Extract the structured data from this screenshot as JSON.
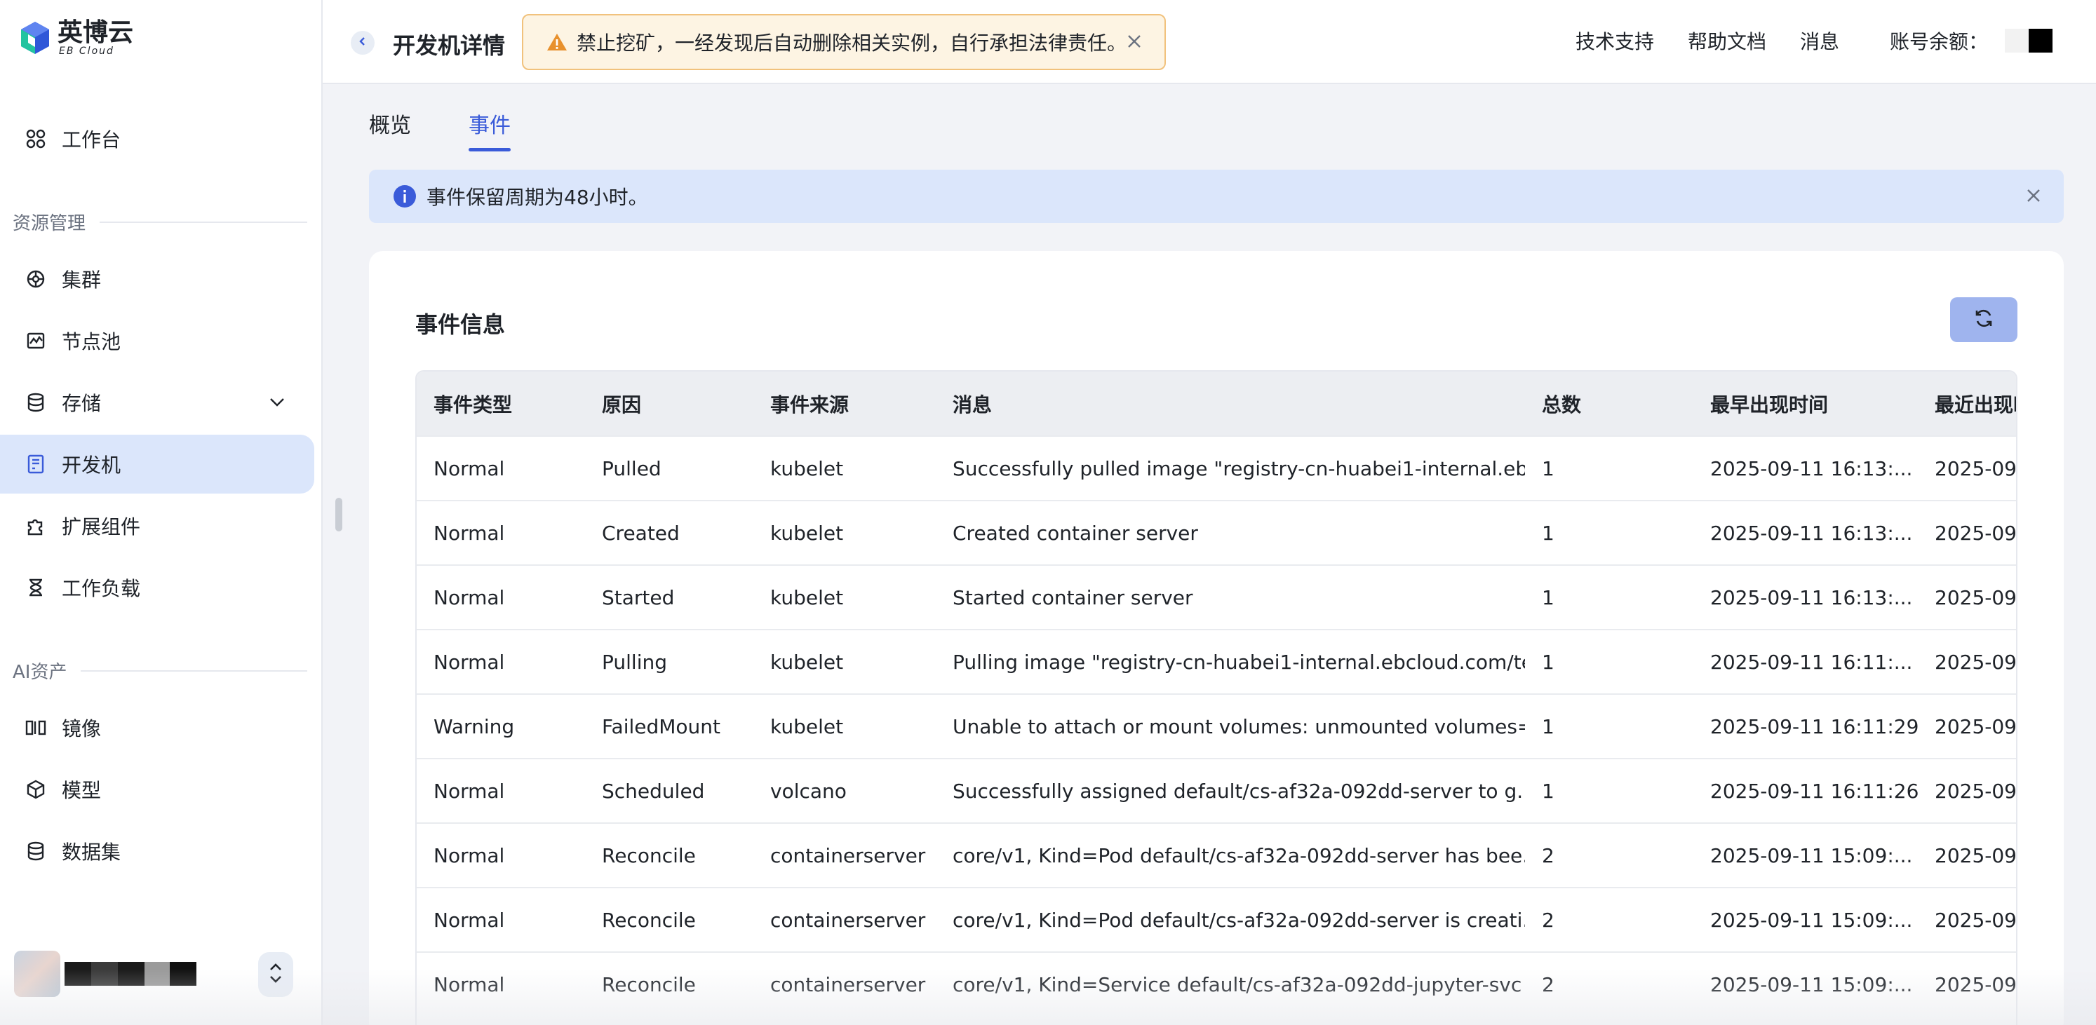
{
  "brand": {
    "name_cn": "英博云",
    "name_en": "EB Cloud"
  },
  "sidebar": {
    "workbench": "工作台",
    "section_resources": "资源管理",
    "resources": [
      {
        "label": "集群",
        "icon": "cluster-icon"
      },
      {
        "label": "节点池",
        "icon": "nodepool-icon"
      },
      {
        "label": "存储",
        "icon": "storage-icon"
      },
      {
        "label": "开发机",
        "icon": "devmachine-icon"
      },
      {
        "label": "扩展组件",
        "icon": "puzzle-icon"
      },
      {
        "label": "工作负载",
        "icon": "hourglass-icon"
      }
    ],
    "section_ai": "AI资产",
    "ai_items": [
      {
        "label": "镜像",
        "icon": "image-icon"
      },
      {
        "label": "模型",
        "icon": "cube-icon"
      },
      {
        "label": "数据集",
        "icon": "database-icon"
      }
    ],
    "active": "开发机"
  },
  "header": {
    "title": "开发机详情",
    "warning": "禁止挖矿，一经发现后自动删除相关实例，自行承担法律责任。",
    "links": [
      "技术支持",
      "帮助文档",
      "消息"
    ],
    "balance_label": "账号余额："
  },
  "tabs": [
    {
      "label": "概览",
      "active": false
    },
    {
      "label": "事件",
      "active": true
    }
  ],
  "info_alert": "事件保留周期为48小时。",
  "events": {
    "title": "事件信息",
    "columns": [
      "事件类型",
      "原因",
      "事件来源",
      "消息",
      "总数",
      "最早出现时间",
      "最近出现时间"
    ],
    "rows": [
      [
        "Normal",
        "Pulled",
        "kubelet",
        "Successfully pulled image \"registry-cn-huabei1-internal.eb...",
        "1",
        "2025-09-11 16:13:...",
        "2025-09"
      ],
      [
        "Normal",
        "Created",
        "kubelet",
        "Created container server",
        "1",
        "2025-09-11 16:13:...",
        "2025-09"
      ],
      [
        "Normal",
        "Started",
        "kubelet",
        "Started container server",
        "1",
        "2025-09-11 16:13:...",
        "2025-09"
      ],
      [
        "Normal",
        "Pulling",
        "kubelet",
        "Pulling image \"registry-cn-huabei1-internal.ebcloud.com/te...",
        "1",
        "2025-09-11 16:11:...",
        "2025-09"
      ],
      [
        "Warning",
        "FailedMount",
        "kubelet",
        "Unable to attach or mount volumes: unmounted volumes=[...",
        "1",
        "2025-09-11 16:11:29",
        "2025-09"
      ],
      [
        "Normal",
        "Scheduled",
        "volcano",
        "Successfully assigned default/cs-af32a-092dd-server to g...",
        "1",
        "2025-09-11 16:11:26",
        "2025-09"
      ],
      [
        "Normal",
        "Reconcile",
        "containerserver",
        "core/v1, Kind=Pod default/cs-af32a-092dd-server has bee...",
        "2",
        "2025-09-11 15:09:...",
        "2025-09"
      ],
      [
        "Normal",
        "Reconcile",
        "containerserver",
        "core/v1, Kind=Pod default/cs-af32a-092dd-server is creati...",
        "2",
        "2025-09-11 15:09:...",
        "2025-09"
      ],
      [
        "Normal",
        "Reconcile",
        "containerserver",
        "core/v1, Kind=Service default/cs-af32a-092dd-jupyter-svc ...",
        "2",
        "2025-09-11 15:09:...",
        "2025-09"
      ]
    ]
  },
  "colors": {
    "accent": "#3a5bd9",
    "active_bg": "#dbe6fb",
    "warning_bg": "#fdf4e3",
    "warning_border": "#f1c27d",
    "warning_icon": "#e8912d"
  }
}
